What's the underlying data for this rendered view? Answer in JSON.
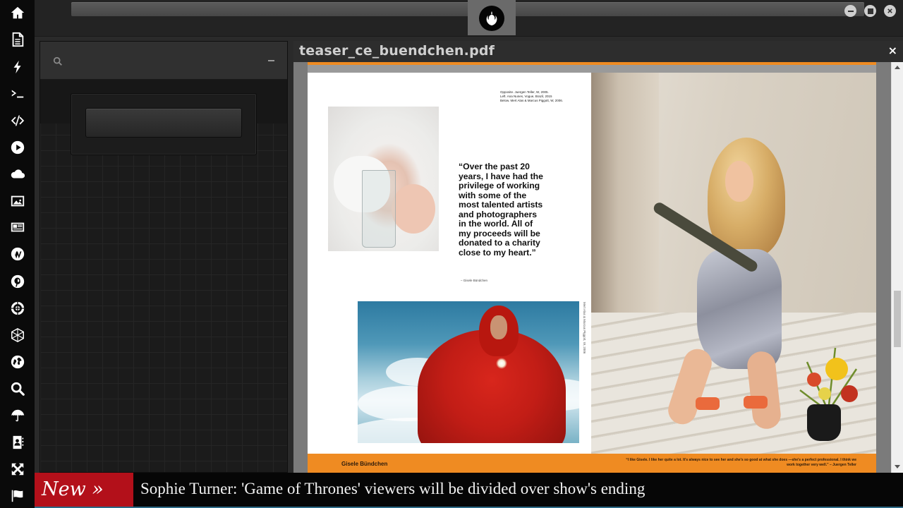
{
  "sidebar": {
    "icons": [
      "home-icon",
      "document-icon",
      "lightning-icon",
      "terminal-icon",
      "code-icon",
      "play-icon",
      "cloud-icon",
      "image-icon",
      "newspaper-icon",
      "wordpress-icon",
      "pinterest-icon",
      "empire-icon",
      "hexagon-network-icon",
      "globe-icon",
      "search-icon",
      "umbrella-icon",
      "contacts-icon",
      "move-arrows-icon",
      "flag-icon"
    ]
  },
  "topbar": {
    "logo": "rebel-alliance-icon",
    "window_controls": [
      "minimize-icon",
      "maximize-icon",
      "close-icon"
    ]
  },
  "left_panel": {
    "search_icon": "search-icon",
    "collapse_icon": "minus-icon",
    "button_label": ""
  },
  "viewer": {
    "title": "teaser_ce_buendchen.pdf",
    "close_label": "×",
    "page": {
      "credits_line1": "Opposite. Juergen Teller, W, 2005.",
      "credits_line2": "Left. Ana Nunes, Vogue, Brazil, 2015",
      "credits_line3": "Below. Mert Alas & Marcus Piggott, W, 2006.",
      "quote": "“Over the past 20 years, I have had the privilege of working with some of the most talented artists and photographers in the world. All of my proceeds will be donated to a charity close to my heart.”",
      "quote_attribution": "– Gisele Bündchen",
      "vertical_credit": "Mert Alas & Marcus Piggott, W, 2006",
      "footer_name": "Gisele Bündchen",
      "footer_quote": "“I like Gisele. I like her quite a lot. It's always nice to see her and she's so good at what she does —she's a perfect professional. I think we work together very well.”",
      "footer_quote_attribution": "– Juergen Teller"
    }
  },
  "ticker": {
    "badge": "New »",
    "headline": "Sophie Turner: 'Game of Thrones' viewers will be divided over show's ending"
  },
  "colors": {
    "accent_orange": "#ef8b22",
    "ticker_red": "#b3101a",
    "ticker_line": "#2c6a86"
  }
}
